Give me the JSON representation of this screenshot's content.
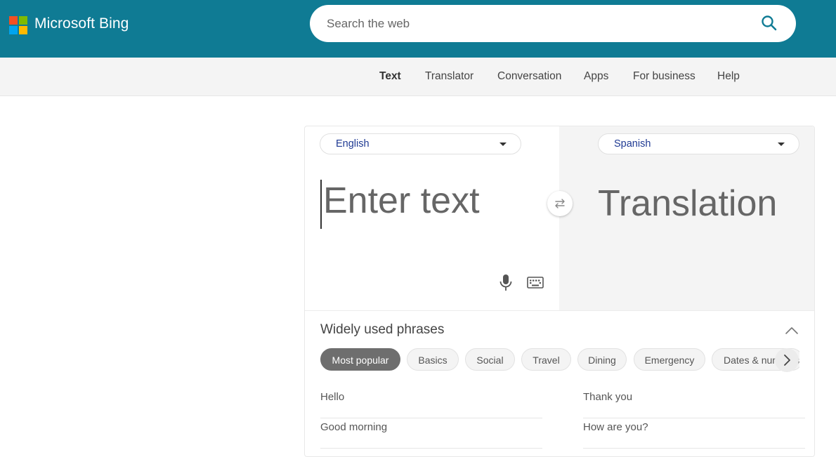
{
  "header": {
    "brand": "Microsoft Bing",
    "logo_colors": [
      "#f25022",
      "#7fba00",
      "#00a4ef",
      "#ffb900"
    ],
    "search_placeholder": "Search the web",
    "search_icon": "search-icon",
    "background": "#0f7b94"
  },
  "nav": {
    "items": [
      "Text",
      "Translator",
      "Conversation",
      "Apps",
      "For business",
      "Help"
    ],
    "active": "Text"
  },
  "translator": {
    "source_language": "English",
    "target_language": "Spanish",
    "input_placeholder": "Enter text",
    "translation_placeholder": "Translation",
    "swap_icon": "swap-icon",
    "mic_icon": "microphone-icon",
    "keyboard_icon": "keyboard-icon"
  },
  "phrases": {
    "title": "Widely used phrases",
    "categories": [
      "Most popular",
      "Basics",
      "Social",
      "Travel",
      "Dining",
      "Emergency",
      "Dates & numbers"
    ],
    "active_category": "Most popular",
    "items": [
      "Hello",
      "Thank you",
      "Good morning",
      "How are you?"
    ]
  }
}
